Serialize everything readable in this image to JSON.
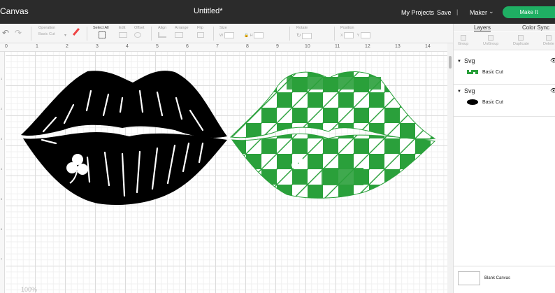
{
  "topbar": {
    "brand": "Canvas",
    "document_title": "Untitled*",
    "my_projects": "My Projects",
    "save": "Save",
    "separator": "|",
    "machine": "Maker",
    "make_it": "Make It"
  },
  "toolbar": {
    "operation_label": "Operation",
    "operation_value": "Basic Cut",
    "select_all": "Select All",
    "edit_label": "Edit",
    "offset_label": "Offset",
    "align_label": "Align",
    "arrange_label": "Arrange",
    "flip_label": "Flip",
    "size_label": "Size",
    "size_w": "W",
    "size_h": "H",
    "rotate_label": "Rotate",
    "position_label": "Position",
    "position_x": "X",
    "position_y": "Y"
  },
  "ruler": {
    "top": [
      "0",
      "1",
      "2",
      "3",
      "4",
      "5",
      "6",
      "7",
      "8",
      "9",
      "10",
      "11",
      "12",
      "13",
      "14"
    ],
    "left": [
      "1",
      "2",
      "3",
      "4",
      "5",
      "6",
      "7"
    ]
  },
  "zoom": "100%",
  "panel": {
    "tabs": [
      "Layers",
      "Color Sync"
    ],
    "tools": [
      "Group",
      "UnGroup",
      "Duplicate",
      "Delete"
    ],
    "groups": [
      {
        "name": "Svg",
        "layer": "Basic Cut",
        "thumb_color": "#2aa03b"
      },
      {
        "name": "Svg",
        "layer": "Basic Cut",
        "thumb_color": "#000000"
      }
    ],
    "blank_canvas": "Blank Canvas"
  },
  "colors": {
    "topbar": "#2b2b2b",
    "make_it": "#1faf63",
    "green_lips": "#2aa03b",
    "black_lips": "#000000"
  }
}
